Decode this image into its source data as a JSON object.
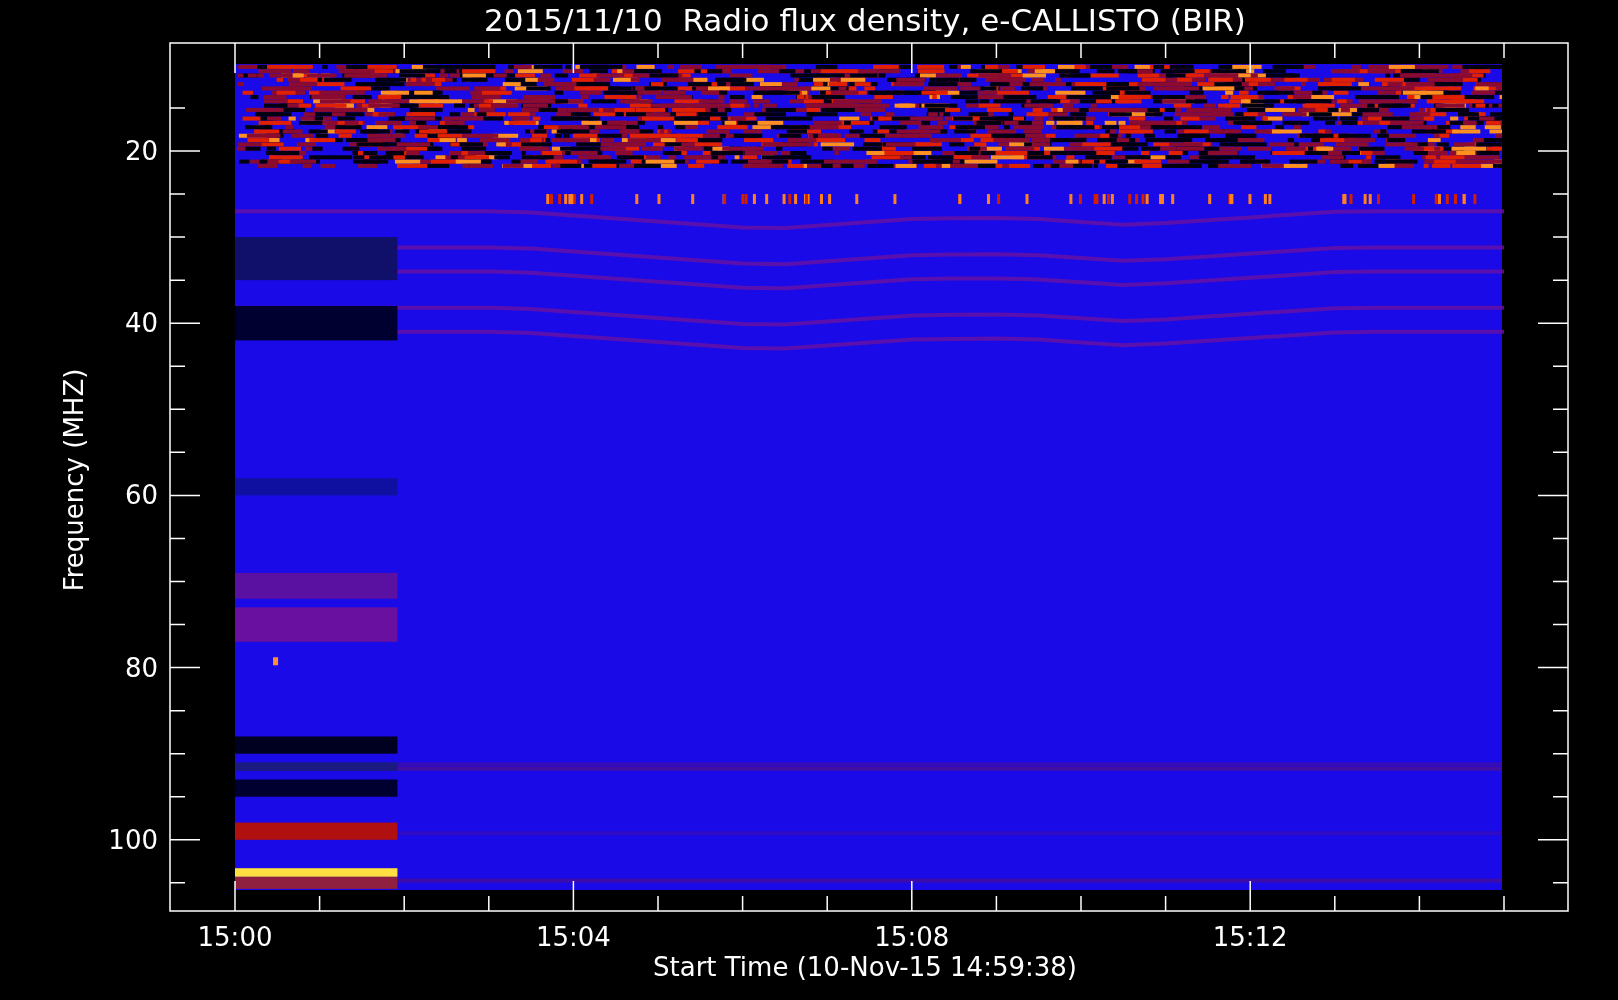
{
  "title": "2015/11/10  Radio flux density, e-CALLISTO (BIR)",
  "plot": {
    "ylabel": "Frequency (MHZ)",
    "xlabel": "Start Time (10-Nov-15 14:59:38)",
    "y_tick_labels": [
      "20",
      "40",
      "60",
      "80",
      "100"
    ],
    "x_tick_labels": [
      "15:00",
      "15:04",
      "15:08",
      "15:12"
    ]
  }
}
